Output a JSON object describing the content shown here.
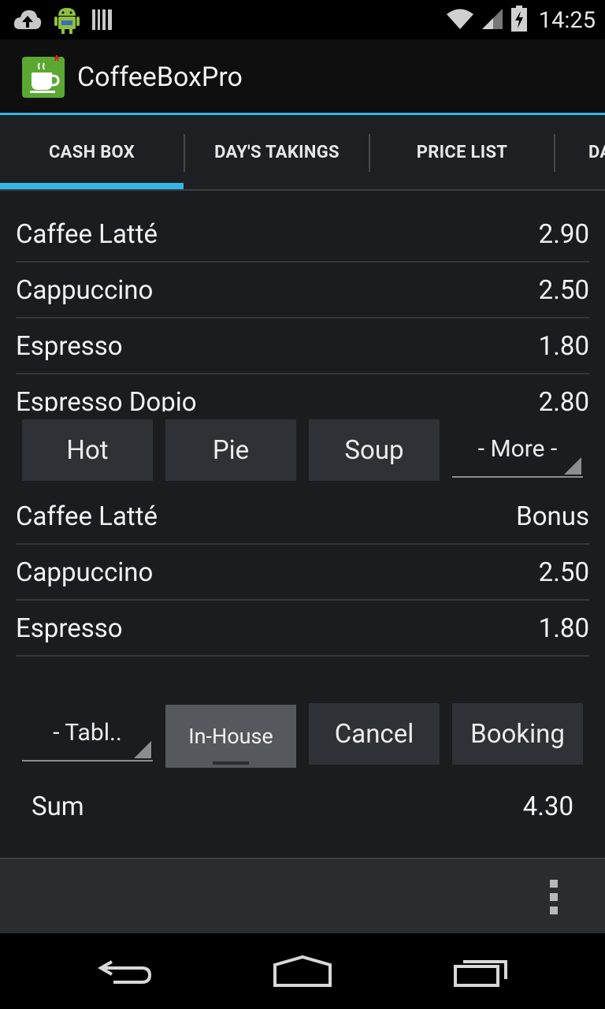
{
  "status_bar": {
    "time": "14:25",
    "icons": [
      "cloud-upload-icon",
      "android-icon",
      "barcode-icon",
      "wifi-icon",
      "signal-icon",
      "battery-charging-icon"
    ]
  },
  "action_bar": {
    "title": "CoffeeBoxPro",
    "icon": "coffee-cup-icon",
    "accent": "#33b5e5"
  },
  "tabs": [
    "CASH BOX",
    "DAY'S TAKINGS",
    "PRICE LIST",
    "DA"
  ],
  "product_list": [
    {
      "name": "Caffee Latté",
      "price": "2.90"
    },
    {
      "name": "Cappuccino",
      "price": "2.50"
    },
    {
      "name": "Espresso",
      "price": "1.80"
    },
    {
      "name": "Espresso Dopio",
      "price": "2.80"
    }
  ],
  "category_buttons": [
    "Hot",
    "Pie",
    "Soup"
  ],
  "more_spinner": "- More -",
  "order_list": [
    {
      "name": "Caffee Latté",
      "price": "Bonus"
    },
    {
      "name": "Cappuccino",
      "price": "2.50"
    },
    {
      "name": "Espresso",
      "price": "1.80"
    }
  ],
  "actions": {
    "table_spinner": "- Tabl..",
    "in_house": "In-House",
    "cancel": "Cancel",
    "booking": "Booking"
  },
  "sum": {
    "label": "Sum",
    "value": "4.30"
  },
  "nav_bar": [
    "back-icon",
    "home-icon",
    "recent-apps-icon"
  ]
}
